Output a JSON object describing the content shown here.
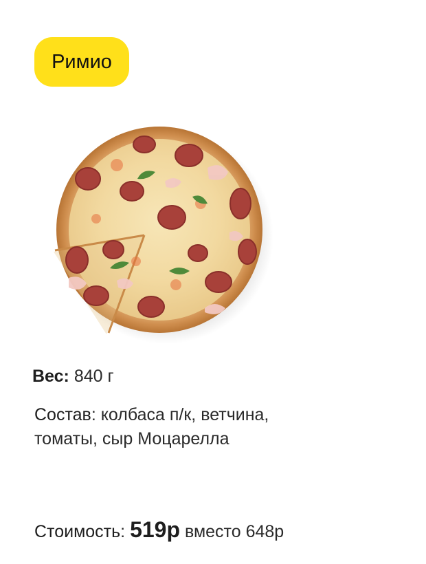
{
  "product": {
    "name": "Римио"
  },
  "weight": {
    "label": "Вес",
    "separator": ":",
    "value": "840 г"
  },
  "composition": {
    "label": "Состав",
    "separator": ":",
    "line1": "колбаса п/к, ветчина,",
    "line2": "томаты, сыр Моцарелла"
  },
  "price": {
    "label": "Стоимость",
    "separator": ":",
    "current": "519р",
    "instead_word": "вместо",
    "old": "648р"
  },
  "colors": {
    "badge": "#ffe01a",
    "text": "#2a2a2a"
  },
  "icons": {
    "pizza_image": "pizza-photo"
  }
}
